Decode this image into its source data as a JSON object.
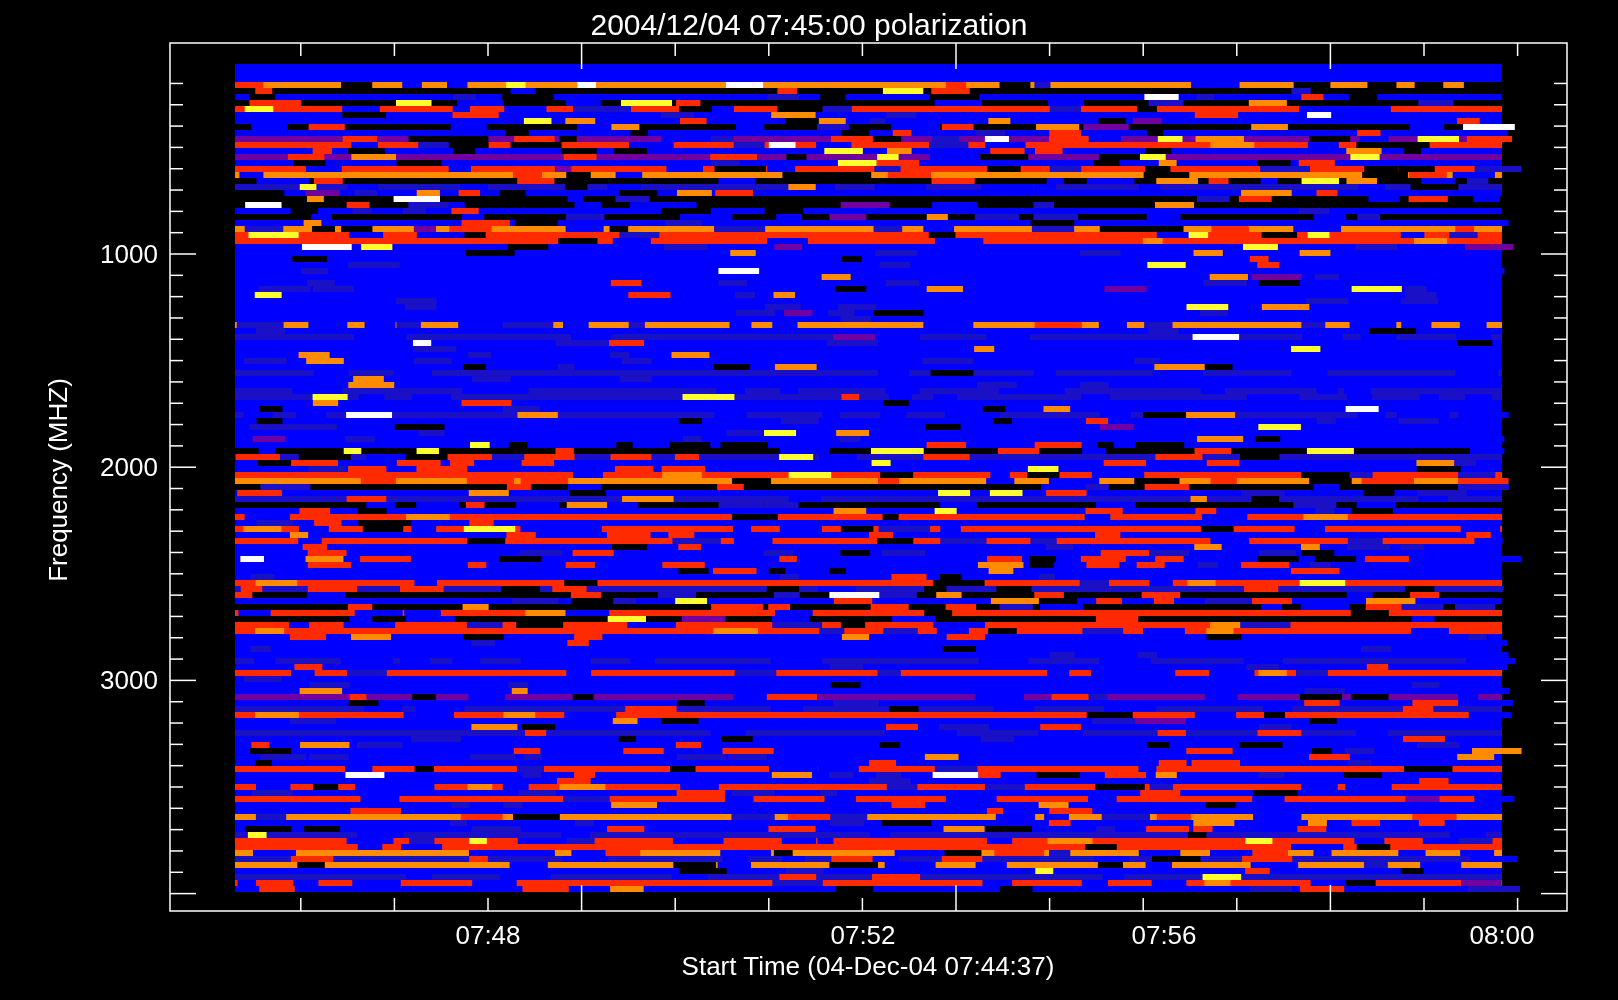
{
  "title": "2004/12/04 07:45:00 polarization",
  "ylabel": "Frequency (MHZ)",
  "yticks": [
    "1000",
    "2000",
    "3000"
  ],
  "xticks": [
    "07:48",
    "07:52",
    "07:56",
    "08:00"
  ],
  "xlabel": "Start Time (04-Dec-04 07:44:37)"
}
